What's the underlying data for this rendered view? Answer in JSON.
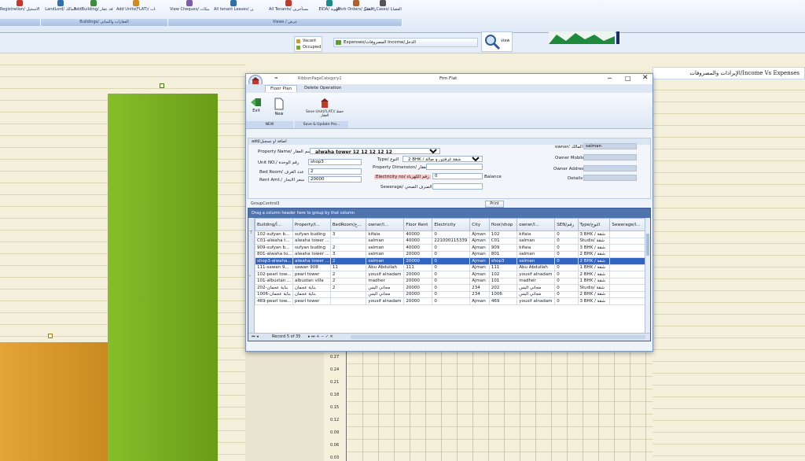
{
  "ribbon": {
    "buttons": [
      {
        "label": "Registration/ الاسجيل",
        "x": 0
      },
      {
        "label": "LandLord/ المالك",
        "x": 52
      },
      {
        "label": "AddBuilding/ اضافة عقار",
        "x": 94
      },
      {
        "label": "Add Units(FLAT)/ اضافة الشقق والوحدات",
        "x": 148
      },
      {
        "label": "View Cheques/ عرض الشيكات",
        "x": 216
      },
      {
        "label": "All tenant Leases/ كل عقود المستأجرين",
        "x": 272
      },
      {
        "label": "All Tenants/ المستأجرين",
        "x": 342
      },
      {
        "label": "EIDA/ الهوية",
        "x": 394
      },
      {
        "label": "Work Orders/ اوامر العمل",
        "x": 428
      },
      {
        "label": "Court Cases/ القضايا",
        "x": 462
      }
    ],
    "groups": [
      {
        "label": "",
        "x": 0,
        "w": 52
      },
      {
        "label": "Buildings/ العقارات والمباني",
        "x": 52,
        "w": 162
      },
      {
        "label": "Views / عرض",
        "x": 214,
        "w": 298
      }
    ]
  },
  "legend": {
    "items": [
      {
        "label": "Vacant",
        "color": "#d8962b"
      },
      {
        "label": "Occupied",
        "color": "#76ad1e"
      }
    ]
  },
  "strip": {
    "tab_label": "Expenses/المصروفات Income/الدخل",
    "view_label": "view"
  },
  "income_title": "الإيرادات والمصروفات/Income Vs Expenses",
  "chart_data": {
    "type": "bar",
    "categories": [
      "Vacant",
      "Occupied"
    ],
    "series": [
      {
        "name": "Vacant",
        "color": "#d8962b"
      },
      {
        "name": "Occupied",
        "color": "#76ad1e"
      }
    ],
    "y_ticks": [
      "0.27",
      "0.24",
      "0.21",
      "0.18",
      "0.15",
      "0.12",
      "0.09",
      "0.06",
      "0.03"
    ]
  },
  "window": {
    "title": "Frm Flat",
    "qat_label": "=",
    "ribbon_page_category": "RibbonPageCategory1",
    "tabs": [
      "Floor Plan",
      "Delete Operation"
    ],
    "buttons": {
      "exit": "Exit",
      "new": "New",
      "save": "Save Unit(FLAT)/ حفظ العقار"
    },
    "group_labels": {
      "new": "NEW",
      "save": "Save & Update Pro..."
    },
    "add_section_label": "add/اضافة او تسجيل",
    "fields": {
      "property_name_label": "Property Name/ اسم العقار",
      "property_name_value": "alwaha tower  12  12  12  12  12",
      "unit_no_label": "Unit NO./ رقم الوحدة",
      "unit_no_value": "shop3",
      "bed_rooms_label": "Bed Room/ عدد الغرف",
      "bed_rooms_value": "2",
      "rent_amt_label": "Rent Amt./ سعر الايجار",
      "rent_amt_value": "20000",
      "type_label": "Type/ النوع",
      "type_value": "2 BHK / شقة غرفتين و صالة",
      "property_dimension_label": "Property Dimension/ مساحة العقار",
      "property_dimension_value": "",
      "electricity_label": "Electricity no/ رقم الكهرباء",
      "electricity_value": "0",
      "balance_label": "Balance",
      "sewerage_label": "Sewerage/ الصرف الصحي",
      "sewerage_value": "",
      "owner_label": "owner/ المالك",
      "owner_value": "salman",
      "owner_mobile_label": "Owner Mobile",
      "owner_mobile_value": "",
      "owner_address_label": "Owner Address",
      "owner_address_value": "",
      "details_label": "Details",
      "details_value": ""
    },
    "group_control_label": "GroupControl3",
    "print_button": "Print",
    "drag_hint": "Drag a column header here to group by that column",
    "columns": [
      "Building/أ...",
      "Property/ا...",
      "BedRoom/ع...",
      "owner/ا...",
      "Floor Rent",
      "Electricity",
      "City",
      "floor/shop",
      "owner/ا...",
      "SEN/رقم",
      "Type/النوع",
      "Sewerage/ا..."
    ],
    "rows": [
      [
        "102-sufyan b...",
        "sufyan buding",
        "3",
        "kifaia",
        "40000",
        "0",
        "Ajman",
        "102",
        "kifaia",
        "0",
        "3 BHK / شقة",
        ""
      ],
      [
        "C01-alwaha t...",
        "alwaha tower ...",
        "",
        "salman",
        "40000",
        "22100011​5339",
        "Ajman",
        "C01",
        "salman",
        "0",
        "Studio/ شقة",
        ""
      ],
      [
        "909-sufyan b...",
        "sufyan buding",
        "2",
        "salman",
        "40000",
        "0",
        "Ajman",
        "909",
        "kifaia",
        "0",
        "3 BHK / شقة",
        ""
      ],
      [
        "801-alwaha to...",
        "alwaha tower ...",
        "3",
        "salman",
        "20000",
        "0",
        "Ajman",
        "801",
        "salman",
        "0",
        "2 BHK / شقة",
        ""
      ],
      [
        "shop3-alwaha...",
        "alwaha tower ...",
        "2",
        "salman",
        "20000",
        "0",
        "Ajman",
        "shop3",
        "salman",
        "0",
        "2 BHK / شقة",
        ""
      ],
      [
        "111-sawan  9...",
        "sawan  908",
        "11",
        "Abu Abdullah",
        "111",
        "0",
        "Ajman",
        "111",
        "Abu Abdullah",
        "0",
        "1 BHK / شقة",
        ""
      ],
      [
        "102-pearl tow...",
        "pearl tower",
        "2",
        "yousif alnadam",
        "20000",
        "0",
        "Ajman",
        "102",
        "yousif alnadam",
        "0",
        "2 BHK / شقة",
        ""
      ],
      [
        "101-albustan ...",
        "albustan villa",
        "2",
        "madher",
        "20000",
        "0",
        "Ajman",
        "101",
        "madher",
        "0",
        "1 BHK / شقة",
        ""
      ],
      [
        "202-بناية عجمان",
        "بناية عجمان",
        "2",
        "مجاني اليس",
        "20000",
        "0",
        "234",
        "202",
        "مجاني اليس",
        "0",
        "Studio/ شقة",
        ""
      ],
      [
        "1006-بناية عجمان",
        "بناية عجمان",
        "",
        "مجاني اليس",
        "20000",
        "0",
        "234",
        "1006",
        "مجاني اليس",
        "0",
        "2 BHK / شقة",
        ""
      ],
      [
        "469-pearl tow...",
        "pearl tower",
        "",
        "yousif alnadam",
        "20000",
        "0",
        "Ajman",
        "469",
        "yousif alnadam",
        "0",
        "3 BHK / شقة",
        ""
      ]
    ],
    "record_label": "Record 5 of 35"
  }
}
